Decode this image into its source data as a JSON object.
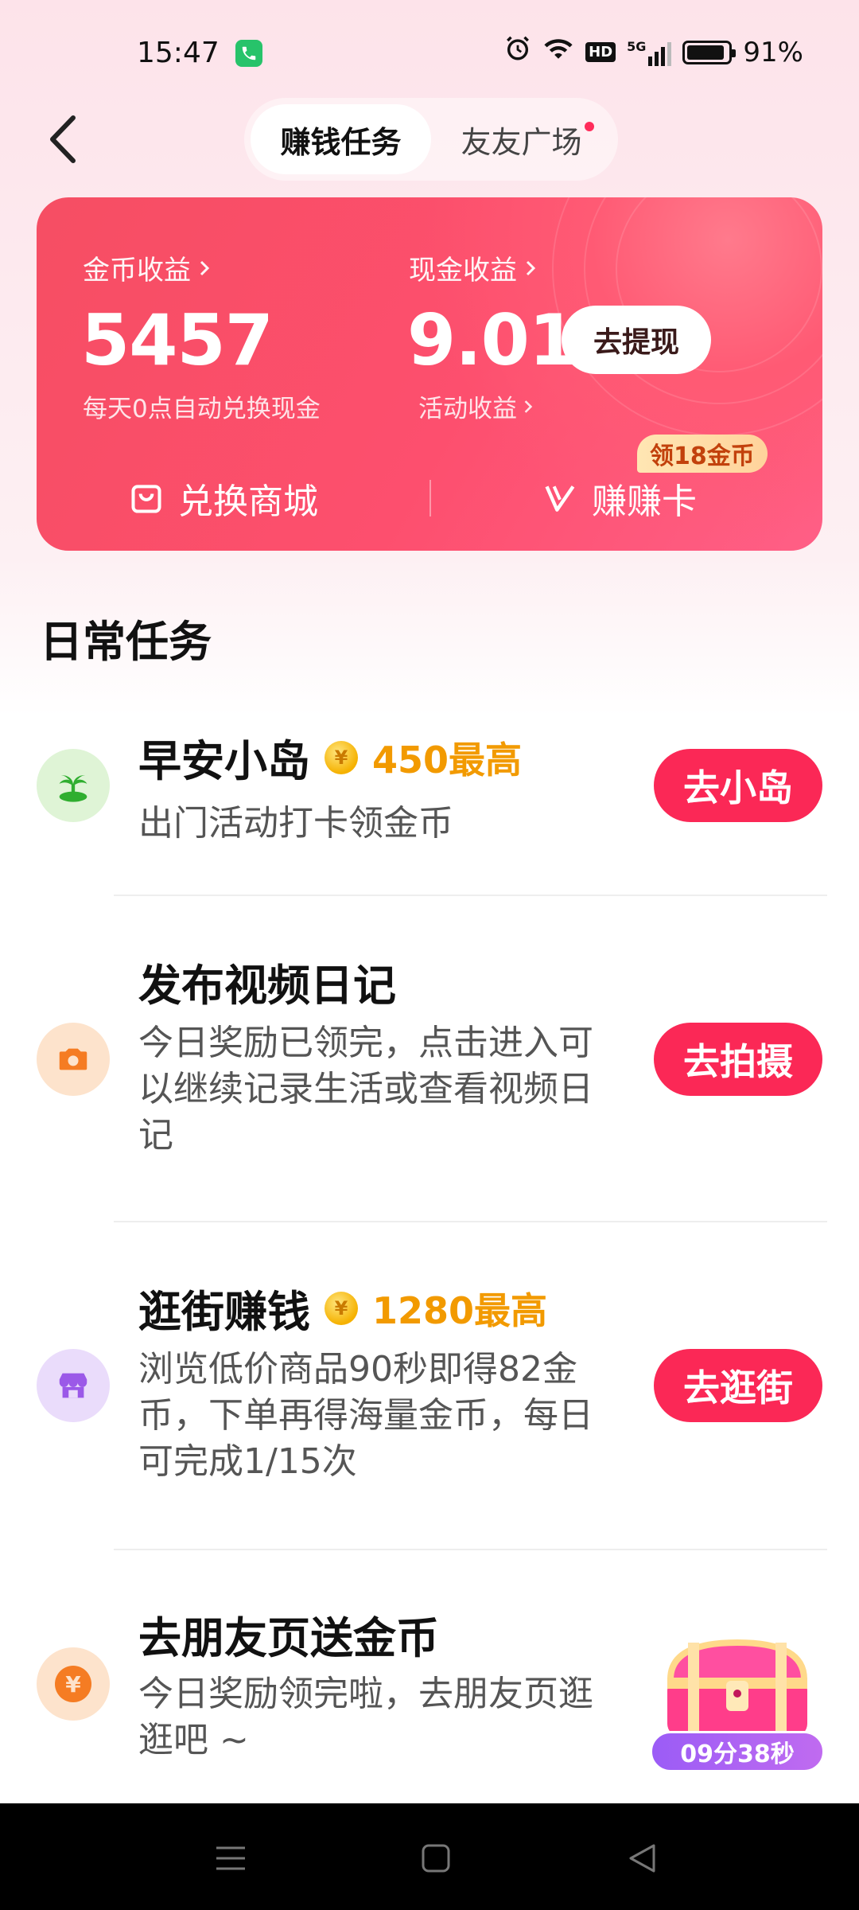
{
  "status_bar": {
    "time": "15:47",
    "battery": "91%",
    "battery_level": 0.91,
    "network": "5G",
    "hd_label": "HD"
  },
  "header": {
    "tabs": [
      {
        "label": "赚钱任务",
        "active": true
      },
      {
        "label": "友友广场",
        "active": false,
        "has_dot": true
      }
    ]
  },
  "earnings": {
    "coin_label": "金币收益",
    "coin_value": "5457",
    "coin_note": "每天0点自动兑换现金",
    "cash_label": "现金收益",
    "cash_value": "9.01",
    "withdraw_label": "去提现",
    "activity_label": "活动收益",
    "mall_label": "兑换商城",
    "card_label": "赚赚卡",
    "card_reward_tag": "领18金币",
    "accent_color": "#fb2856"
  },
  "section": {
    "title": "日常任务"
  },
  "tasks": [
    {
      "title": "早安小岛",
      "reward": "450最高",
      "desc": "出门活动打卡领金币",
      "button": "去小岛",
      "icon": "island-icon"
    },
    {
      "title": "发布视频日记",
      "reward": "",
      "desc": "今日奖励已领完，点击进入可以继续记录生活或查看视频日记",
      "button": "去拍摄",
      "icon": "camera-icon"
    },
    {
      "title": "逛街赚钱",
      "reward": "1280最高",
      "desc": "浏览低价商品90秒即得82金币，下单再得海量金币，每日可完成1/15次",
      "button": "去逛街",
      "icon": "shop-icon"
    },
    {
      "title": "去朋友页送金币",
      "reward": "",
      "desc": "今日奖励领完啦，去朋友页逛逛吧 ~",
      "button": "",
      "icon": "yuan-icon"
    }
  ],
  "floating": {
    "timer": "09分38秒",
    "icon": "treasure-chest-icon"
  }
}
